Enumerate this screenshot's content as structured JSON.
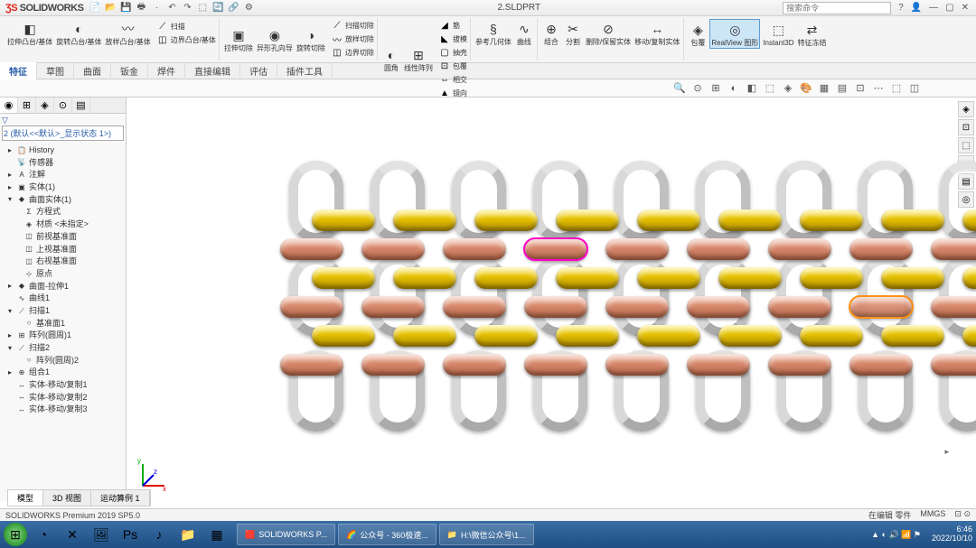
{
  "app": {
    "name": "SOLIDWORKS",
    "doc_title": "2.SLDPRT"
  },
  "search": {
    "placeholder": "搜索命令"
  },
  "qat": [
    "新建",
    "打开",
    "保存",
    "打印",
    "撤销",
    "重做",
    "选择",
    "重建",
    "选项"
  ],
  "ribbon": {
    "groups": [
      {
        "buttons": [
          {
            "icon": "◧",
            "label": "拉伸凸台/基体"
          },
          {
            "icon": "◐",
            "label": "旋转凸台/基体"
          },
          {
            "icon": "〰",
            "label": "放样凸台/基体"
          }
        ],
        "side": [
          {
            "icon": "⟋",
            "label": "扫描"
          },
          {
            "icon": "◫",
            "label": "边界凸台/基体"
          }
        ]
      },
      {
        "buttons": [
          {
            "icon": "▣",
            "label": "拉伸切除"
          },
          {
            "icon": "◉",
            "label": "异形孔向导"
          },
          {
            "icon": "◑",
            "label": "旋转切除"
          }
        ],
        "side": [
          {
            "icon": "⟋",
            "label": "扫描切除"
          },
          {
            "icon": "〰",
            "label": "放样切除"
          },
          {
            "icon": "◫",
            "label": "边界切除"
          }
        ]
      },
      {
        "buttons": [
          {
            "icon": "◐",
            "label": "圆角"
          },
          {
            "icon": "⊞",
            "label": "线性阵列"
          }
        ],
        "side": [
          {
            "icon": "◢",
            "label": "筋"
          },
          {
            "icon": "◣",
            "label": "拔模"
          },
          {
            "icon": "▢",
            "label": "抽壳"
          },
          {
            "icon": "⊡",
            "label": "包覆"
          },
          {
            "icon": "⇔",
            "label": "相交"
          },
          {
            "icon": "▲",
            "label": "镜向"
          }
        ]
      },
      {
        "buttons": [
          {
            "icon": "§",
            "label": "参考几何体"
          },
          {
            "icon": "∿",
            "label": "曲线"
          }
        ]
      },
      {
        "buttons": [
          {
            "icon": "⊕",
            "label": "组合"
          },
          {
            "icon": "✂",
            "label": "分割"
          },
          {
            "icon": "⊘",
            "label": "删除/保留实体"
          },
          {
            "icon": "↔",
            "label": "移动/复制实体"
          }
        ]
      },
      {
        "buttons": [
          {
            "icon": "◈",
            "label": "包覆"
          },
          {
            "icon": "◎",
            "label": "RealView 图形",
            "hl": true
          },
          {
            "icon": "⬚",
            "label": "Instant3D"
          },
          {
            "icon": "⇄",
            "label": "特征冻结"
          }
        ]
      }
    ]
  },
  "tabs": [
    "特征",
    "草图",
    "曲面",
    "钣金",
    "焊件",
    "直接编辑",
    "评估",
    "插件工具"
  ],
  "active_tab": 0,
  "viewtoolbar": [
    "🔍",
    "⊙",
    "⊞",
    "◐",
    "◧",
    "⬚",
    "◈",
    "🎨",
    "▦",
    "▤",
    "⊡",
    "⋯",
    "⬚",
    "◫"
  ],
  "side_tabs": [
    "◉",
    "⊞",
    "◈",
    "⊙",
    "▤"
  ],
  "config_dropdown": "2 (默认<<默认>_显示状态 1>)",
  "tree": [
    {
      "lvl": 0,
      "icon": "▸",
      "ic": "📋",
      "label": "History"
    },
    {
      "lvl": 0,
      "icon": "",
      "ic": "📡",
      "label": "传感器"
    },
    {
      "lvl": 0,
      "icon": "▸",
      "ic": "A",
      "label": "注解"
    },
    {
      "lvl": 0,
      "icon": "▸",
      "ic": "▣",
      "label": "实体(1)"
    },
    {
      "lvl": 0,
      "icon": "▾",
      "ic": "◆",
      "label": "曲面实体(1)"
    },
    {
      "lvl": 1,
      "icon": "",
      "ic": "Σ",
      "label": "方程式"
    },
    {
      "lvl": 1,
      "icon": "",
      "ic": "◈",
      "label": "材质 <未指定>"
    },
    {
      "lvl": 1,
      "icon": "",
      "ic": "◫",
      "label": "前视基准面"
    },
    {
      "lvl": 1,
      "icon": "",
      "ic": "◫",
      "label": "上视基准面"
    },
    {
      "lvl": 1,
      "icon": "",
      "ic": "◫",
      "label": "右视基准面"
    },
    {
      "lvl": 1,
      "icon": "",
      "ic": "⊹",
      "label": "原点"
    },
    {
      "lvl": 0,
      "icon": "▸",
      "ic": "◆",
      "label": "曲面-拉伸1"
    },
    {
      "lvl": 0,
      "icon": "",
      "ic": "∿",
      "label": "曲线1"
    },
    {
      "lvl": 0,
      "icon": "▾",
      "ic": "⟋",
      "label": "扫描1"
    },
    {
      "lvl": 1,
      "icon": "",
      "ic": "○",
      "label": "基准面1"
    },
    {
      "lvl": 0,
      "icon": "▸",
      "ic": "⊞",
      "label": "阵列(圆周)1"
    },
    {
      "lvl": 0,
      "icon": "▾",
      "ic": "⟋",
      "label": "扫描2"
    },
    {
      "lvl": 1,
      "icon": "",
      "ic": "○",
      "label": "阵列(圆周)2"
    },
    {
      "lvl": 0,
      "icon": "▸",
      "ic": "⊕",
      "label": "组合1"
    },
    {
      "lvl": 0,
      "icon": "",
      "ic": "↔",
      "label": "实体-移动/复制1"
    },
    {
      "lvl": 0,
      "icon": "",
      "ic": "↔",
      "label": "实体-移动/复制2"
    },
    {
      "lvl": 0,
      "icon": "",
      "ic": "↔",
      "label": "实体-移动/复制3"
    }
  ],
  "vp_side": [
    "◈",
    "⊡",
    "⬚",
    "◐",
    "▤",
    "◎"
  ],
  "bottom_view_tabs": [
    "模型",
    "3D 视图",
    "运动算例 1"
  ],
  "status": {
    "left": "SOLIDWORKS Premium 2019 SP5.0",
    "r1": "在编辑 零件",
    "r2": "MMGS",
    "r3": ""
  },
  "taskbar": {
    "pinned": [
      "◔",
      "✕",
      "🖼",
      "Ps",
      "♪",
      "📁",
      "▦"
    ],
    "apps": [
      {
        "icon": "🟥",
        "label": "SOLIDWORKS P..."
      },
      {
        "icon": "🌈",
        "label": "公众号 - 360极速..."
      },
      {
        "icon": "📁",
        "label": "H:\\微信公众号\\1..."
      }
    ],
    "tray": [
      "◐",
      "🔊",
      "📶",
      "⚑"
    ],
    "time": "6:46",
    "date": "2022/10/10"
  },
  "triad": {
    "x": "x",
    "y": "y",
    "z": "z"
  }
}
